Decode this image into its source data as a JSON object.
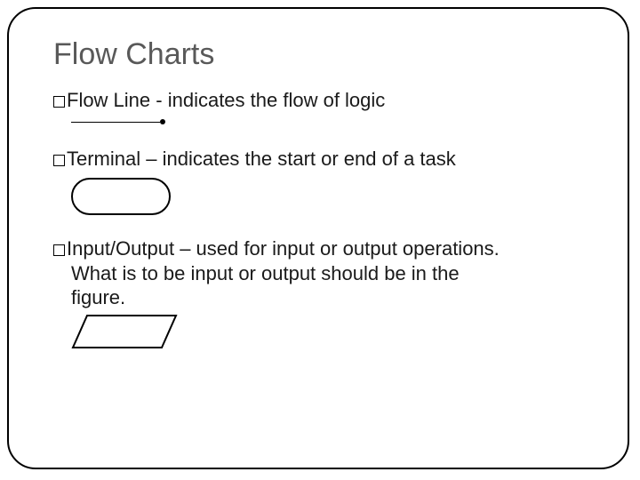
{
  "title": "Flow Charts",
  "items": [
    {
      "label_first": "Flow Line -  indicates the flow of logic"
    },
    {
      "label_first": "Terminal – indicates the start or end of a task"
    },
    {
      "label_first": "Input/Output – used for input or output operations.",
      "label_cont1": "What is to be input or output should be in the",
      "label_cont2": "figure."
    }
  ]
}
